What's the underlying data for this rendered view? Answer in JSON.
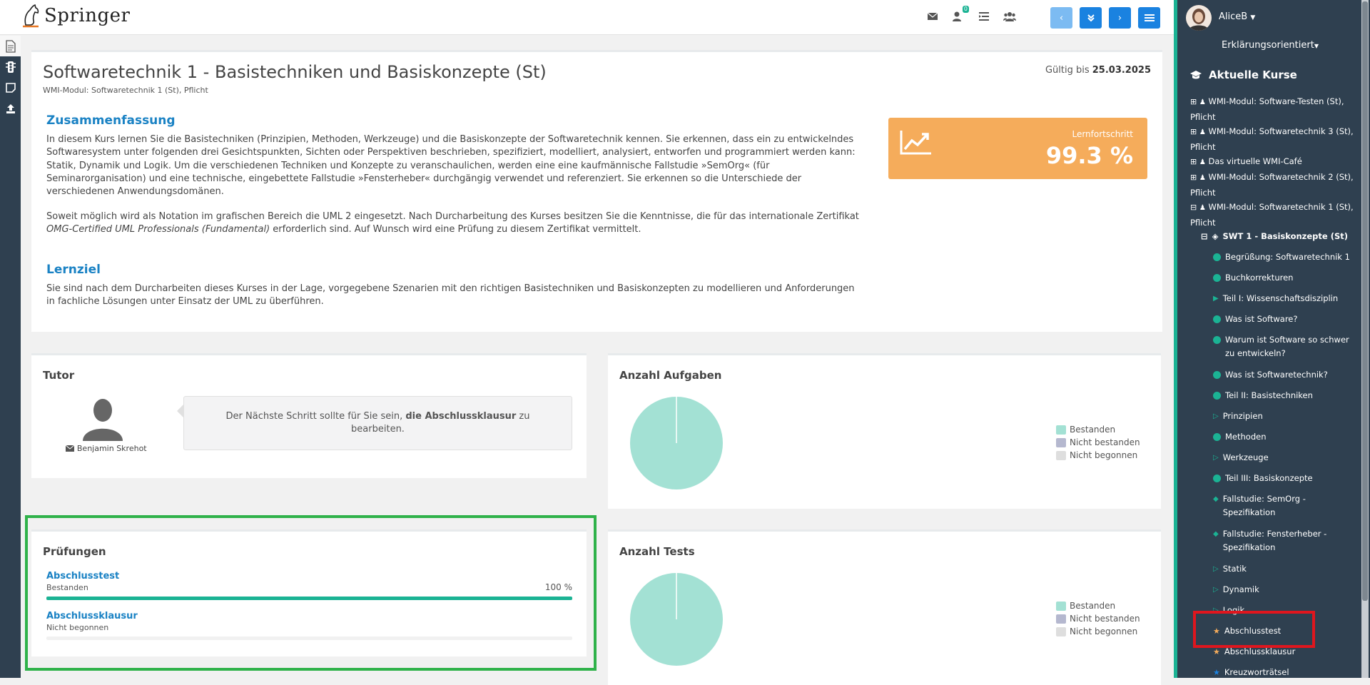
{
  "header": {
    "brand": "Springer",
    "notification_count": "0"
  },
  "course": {
    "title": "Softwaretechnik 1 - Basistechniken und Basiskonzepte (St)",
    "subtitle": "WMI-Modul: Softwaretechnik 1 (St), Pflicht",
    "valid_label": "Gültig bis",
    "valid_date": "25.03.2025",
    "summary_heading": "Zusammenfassung",
    "summary_p1": "In diesem Kurs lernen Sie die Basistechniken (Prinzipien, Methoden, Werkzeuge) und die Basiskonzepte der Softwaretechnik kennen. Sie erkennen, dass ein zu entwickelndes Softwaresystem unter folgenden drei Gesichtspunkten, Sichten oder Perspektiven beschrieben, spezifiziert, modelliert, analysiert, entworfen und programmiert werden kann: Statik, Dynamik und Logik. Um die verschiedenen Techniken und Konzepte zu veranschaulichen, werden eine eine kaufmännische Fallstudie »SemOrg« (für Seminarorganisation) und eine technische, eingebettete Fallstudie »Fensterheber« durchgängig verwendet und referenziert. Sie erkennen so die Unterschiede der verschiedenen Anwendungsdomänen.",
    "summary_p2_a": "Soweit möglich wird als Notation im grafischen Bereich die UML 2 eingesetzt. Nach Durcharbeitung des Kurses besitzen Sie die Kenntnisse, die für das internationale Zertifikat ",
    "summary_p2_em": "OMG-Certified UML Professionals (Fundamental)",
    "summary_p2_b": " erforderlich sind. Auf Wunsch wird eine Prüfung zu diesem Zertifikat vermittelt.",
    "goal_heading": "Lernziel",
    "goal_text": "Sie sind nach dem Durcharbeiten dieses Kurses in der Lage, vorgegebene Szenarien mit den richtigen Basistechniken und Basiskonzepten zu modellieren und Anforderungen in fachliche Lösungen unter Einsatz der UML zu überführen.",
    "progress_label": "Lernfortschritt",
    "progress_value": "99.3 %"
  },
  "tutor": {
    "heading": "Tutor",
    "name": "Benjamin Skrehot",
    "msg_a": "Der Nächste Schritt sollte für Sie sein, ",
    "msg_b": "die Abschlussklausur",
    "msg_c": " zu bearbeiten."
  },
  "exams": {
    "heading": "Prüfungen",
    "items": [
      {
        "name": "Abschlusstest",
        "status": "Bestanden",
        "percent": "100 %",
        "progress": 1.0
      },
      {
        "name": "Abschlussklausur",
        "status": "Nicht begonnen",
        "percent": "",
        "progress": 0.0
      }
    ]
  },
  "charts": {
    "legend": [
      "Bestanden",
      "Nicht bestanden",
      "Nicht begonnen"
    ],
    "colors": [
      "#a3e1d4",
      "#b5b8cf",
      "#dedede"
    ]
  },
  "chart_data": [
    {
      "type": "pie",
      "title": "Anzahl Aufgaben",
      "categories": [
        "Bestanden",
        "Nicht bestanden",
        "Nicht begonnen"
      ],
      "values": [
        100,
        0,
        0
      ]
    },
    {
      "type": "pie",
      "title": "Anzahl Tests",
      "categories": [
        "Bestanden",
        "Nicht bestanden",
        "Nicht begonnen"
      ],
      "values": [
        100,
        0,
        0
      ]
    }
  ],
  "sidebar": {
    "user": "AliceB",
    "mode": "Erklärungsorientiert",
    "current_heading": "Aktuelle Kurse",
    "courses": [
      {
        "l1": "WMI-Modul: Software-Testen (St),",
        "l2": "Pflicht"
      },
      {
        "l1": "WMI-Modul: Softwaretechnik 3 (St),",
        "l2": "Pflicht"
      },
      {
        "l1": "Das virtuelle WMI-Café",
        "l2": ""
      },
      {
        "l1": "WMI-Modul: Softwaretechnik 2 (St),",
        "l2": "Pflicht"
      },
      {
        "l1": "WMI-Modul: Softwaretechnik 1 (St),",
        "l2": "Pflicht"
      }
    ],
    "open_course": "SWT 1 - Basiskonzepte (St)",
    "chapters": [
      {
        "l1": "Begrüßung: Softwaretechnik 1",
        "l2": "",
        "icon": "dot"
      },
      {
        "l1": "Buchkorrekturen",
        "l2": "",
        "icon": "dot"
      },
      {
        "l1": "Teil I: Wissenschaftsdisziplin",
        "l2": "",
        "icon": "play"
      },
      {
        "l1": "Was ist Software?",
        "l2": "",
        "icon": "dot"
      },
      {
        "l1": "Warum ist Software so schwer",
        "l2": "zu entwickeln?",
        "icon": "dot"
      },
      {
        "l1": "Was ist Softwaretechnik?",
        "l2": "",
        "icon": "dot"
      },
      {
        "l1": "Teil II: Basistechniken",
        "l2": "",
        "icon": "dot"
      },
      {
        "l1": "Prinzipien",
        "l2": "",
        "icon": "play-outline"
      },
      {
        "l1": "Methoden",
        "l2": "",
        "icon": "dot"
      },
      {
        "l1": "Werkzeuge",
        "l2": "",
        "icon": "play-outline"
      },
      {
        "l1": "Teil III: Basiskonzepte",
        "l2": "",
        "icon": "dot"
      },
      {
        "l1": "Fallstudie: SemOrg -",
        "l2": "Spezifikation",
        "icon": "diamond"
      },
      {
        "l1": "Fallstudie: Fensterheber -",
        "l2": "Spezifikation",
        "icon": "diamond"
      },
      {
        "l1": "Statik",
        "l2": "",
        "icon": "play-outline"
      },
      {
        "l1": "Dynamik",
        "l2": "",
        "icon": "play-outline"
      },
      {
        "l1": "Logik",
        "l2": "",
        "icon": "play-outline"
      },
      {
        "l1": "Abschlusstest",
        "l2": "",
        "icon": "star-orange"
      },
      {
        "l1": "Abschlussklausur",
        "l2": "",
        "icon": "star-orange"
      },
      {
        "l1": "Kreuzworträtsel",
        "l2": "",
        "icon": "star-blue"
      }
    ]
  }
}
